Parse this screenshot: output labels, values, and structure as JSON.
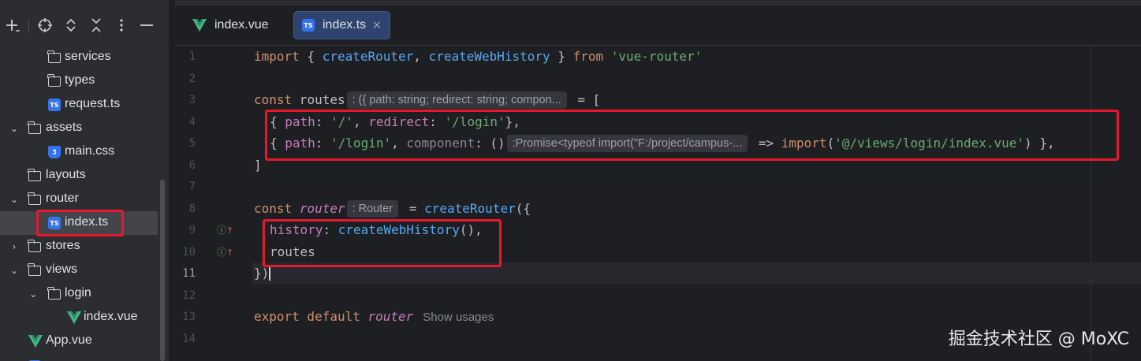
{
  "sidebar": {
    "toolbar": [
      {
        "name": "add-icon",
        "glyph": "+"
      },
      {
        "name": "locate-icon",
        "glyph": "⊕"
      },
      {
        "name": "expand-all-icon",
        "glyph": "⌃"
      },
      {
        "name": "collapse-all-icon",
        "glyph": "✕"
      },
      {
        "name": "more-icon",
        "glyph": "⋮"
      },
      {
        "name": "hide-icon",
        "glyph": "—"
      }
    ],
    "tree": [
      {
        "label": "services",
        "type": "folder",
        "level": 2,
        "expanded": null
      },
      {
        "label": "types",
        "type": "folder",
        "level": 2,
        "expanded": null
      },
      {
        "label": "request.ts",
        "type": "ts",
        "level": 2,
        "expanded": null
      },
      {
        "label": "assets",
        "type": "folder",
        "level": 1,
        "expanded": true
      },
      {
        "label": "main.css",
        "type": "css",
        "level": 2,
        "expanded": null
      },
      {
        "label": "layouts",
        "type": "folder",
        "level": 1,
        "expanded": null
      },
      {
        "label": "router",
        "type": "folder",
        "level": 1,
        "expanded": true
      },
      {
        "label": "index.ts",
        "type": "ts",
        "level": 2,
        "expanded": null,
        "selected": true
      },
      {
        "label": "stores",
        "type": "folder",
        "level": 1,
        "expanded": false
      },
      {
        "label": "views",
        "type": "folder",
        "level": 1,
        "expanded": true
      },
      {
        "label": "login",
        "type": "folder",
        "level": 2,
        "expanded": true
      },
      {
        "label": "index.vue",
        "type": "vue",
        "level": 3,
        "expanded": null
      },
      {
        "label": "App.vue",
        "type": "vue",
        "level": 1,
        "expanded": null
      }
    ]
  },
  "tabs": [
    {
      "label": "index.vue",
      "icon": "vue-icon",
      "active": false
    },
    {
      "label": "index.ts",
      "icon": "ts-icon",
      "active": true,
      "closable": "×"
    }
  ],
  "editor": {
    "line_numbers": [
      "1",
      "2",
      "3",
      "4",
      "5",
      "6",
      "7",
      "8",
      "9",
      "10",
      "11",
      "12",
      "13",
      "14"
    ],
    "current_line": "11",
    "line1": {
      "import": "import",
      "open": " { ",
      "createRouter": "createRouter",
      "comma": ", ",
      "createWebHistory": "createWebHistory",
      "close": " } ",
      "from": "from",
      "module": "'vue-router'"
    },
    "line3": {
      "const": "const",
      "name": " routes",
      "hint": ": ({ path: string; redirect: string; compon...",
      "rest": " = ["
    },
    "line4": {
      "open": "{ ",
      "path": "path",
      "colon": ": ",
      "value": "'/'",
      "comma": ", ",
      "redirect": "redirect",
      "colon2": ": ",
      "value2": "'/login'",
      "close": "},"
    },
    "line5": {
      "open": "{ ",
      "path": "path",
      "colon": ": ",
      "value": "'/login'",
      "comma": ", ",
      "component": "component",
      "colon2": ": ",
      "parens": "()",
      "hint": ":Promise<typeof import(\"F:/project/campus-...",
      "arrow": " => ",
      "import": "import",
      "popen": "(",
      "value2": "'@/views/login/index.vue'",
      "close": ") },"
    },
    "line6": "]",
    "line8": {
      "const": "const",
      "name": "router",
      "hint": ": Router",
      "eq": " = ",
      "fn": "createRouter",
      "open": "({"
    },
    "line9": {
      "history": "history",
      "colon": ": ",
      "fn": "createWebHistory",
      "rest": "(),"
    },
    "line10": "routes",
    "line11": "})",
    "line13": {
      "export": "export",
      "default": " default ",
      "name": "router",
      "usages": "Show usages"
    },
    "gutter_icons": {
      "line9": "↑",
      "line10": "↑"
    }
  },
  "watermark": "掘金技术社区 @ MoXC",
  "colors": {
    "highlight_box": "#e8182c",
    "keyword": "#cf8e6d",
    "function": "#56a8f5",
    "string": "#6aab73",
    "property": "#c77dbb"
  }
}
